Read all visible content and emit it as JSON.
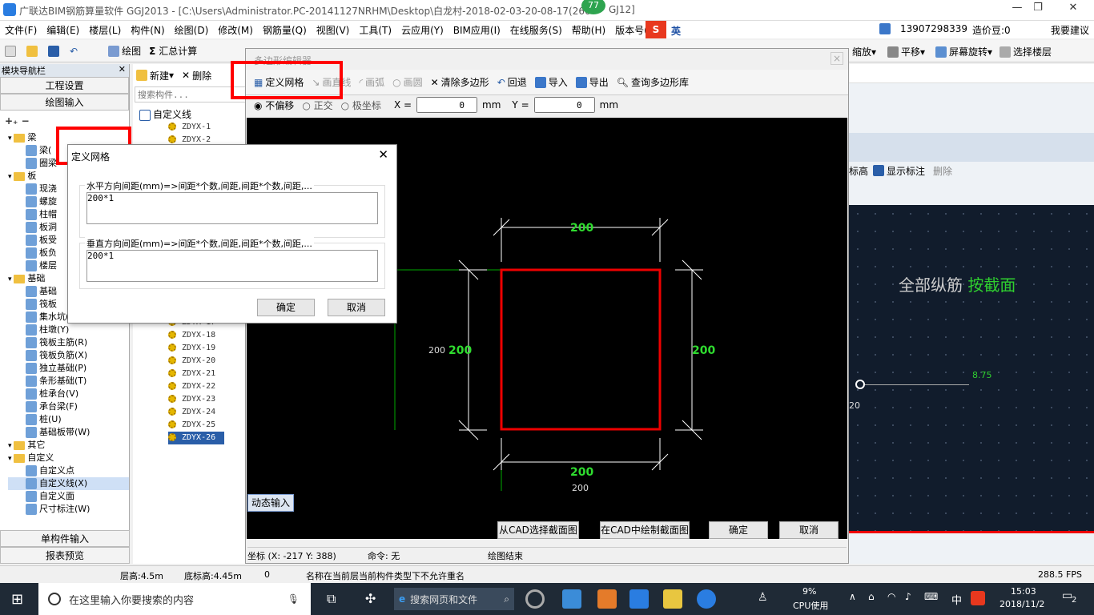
{
  "titlebar": {
    "title": "广联达BIM钢筋算量软件 GGJ2013 - [C:\\Users\\Administrator.PC-20141127NRHM\\Desktop\\白龙村-2018-02-03-20-08-17(266",
    "title_tail": "GJ12]",
    "badge": "77",
    "ime": "英",
    "minimize": "—",
    "restore": "❐",
    "close": "✕"
  },
  "menu": [
    "文件(F)",
    "编辑(E)",
    "楼层(L)",
    "构件(N)",
    "绘图(D)",
    "修改(M)",
    "钢筋量(Q)",
    "视图(V)",
    "工具(T)",
    "云应用(Y)",
    "BIM应用(I)",
    "在线服务(S)",
    "帮助(H)",
    "版本号(B)"
  ],
  "account": {
    "phone": "13907298339",
    "coins": "造价豆:0",
    "feedback": "我要建议"
  },
  "toolbar": {
    "draw": "绘图",
    "sum": "汇总计算",
    "zoom": "缩放",
    "pan": "平移",
    "rotate": "屏幕旋转",
    "select_floor": "选择楼层"
  },
  "nav": {
    "title": "模块导航栏",
    "project": "工程设置",
    "draw_input": "绘图输入",
    "single_input": "单构件输入",
    "report": "报表预览"
  },
  "tree": [
    {
      "t": "梁",
      "lvl": 0,
      "folder": true
    },
    {
      "t": "梁(",
      "lvl": 1
    },
    {
      "t": "圈梁",
      "lvl": 1
    },
    {
      "t": "板",
      "lvl": 0,
      "folder": true
    },
    {
      "t": "现浇",
      "lvl": 1
    },
    {
      "t": "螺旋",
      "lvl": 1
    },
    {
      "t": "柱帽",
      "lvl": 1
    },
    {
      "t": "板洞",
      "lvl": 1
    },
    {
      "t": "板受",
      "lvl": 1
    },
    {
      "t": "板负",
      "lvl": 1
    },
    {
      "t": "楼层",
      "lvl": 1
    },
    {
      "t": "基础",
      "lvl": 0,
      "folder": true
    },
    {
      "t": "基础",
      "lvl": 1
    },
    {
      "t": "筏板",
      "lvl": 1
    },
    {
      "t": "集水坑(K)",
      "lvl": 1
    },
    {
      "t": "柱墩(Y)",
      "lvl": 1
    },
    {
      "t": "筏板主筋(R)",
      "lvl": 1
    },
    {
      "t": "筏板负筋(X)",
      "lvl": 1
    },
    {
      "t": "独立基础(P)",
      "lvl": 1
    },
    {
      "t": "条形基础(T)",
      "lvl": 1
    },
    {
      "t": "桩承台(V)",
      "lvl": 1
    },
    {
      "t": "承台梁(F)",
      "lvl": 1
    },
    {
      "t": "桩(U)",
      "lvl": 1
    },
    {
      "t": "基础板带(W)",
      "lvl": 1
    },
    {
      "t": "其它",
      "lvl": 0,
      "folder": true
    },
    {
      "t": "自定义",
      "lvl": 0,
      "folder": true
    },
    {
      "t": "自定义点",
      "lvl": 1
    },
    {
      "t": "自定义线(X)",
      "lvl": 1,
      "sel": true
    },
    {
      "t": "自定义面",
      "lvl": 1
    },
    {
      "t": "尺寸标注(W)",
      "lvl": 1
    }
  ],
  "mid": {
    "new": "新建",
    "delete": "删除",
    "search_ph": "搜索构件...",
    "root": "自定义线",
    "items": [
      "ZDYX-1",
      "ZDYX-2",
      "ZDYX-16",
      "ZDYX-17",
      "ZDYX-18",
      "ZDYX-19",
      "ZDYX-20",
      "ZDYX-21",
      "ZDYX-22",
      "ZDYX-23",
      "ZDYX-24",
      "ZDYX-25",
      "ZDYX-26"
    ]
  },
  "poly": {
    "title": "多边形编辑器",
    "define_grid": "定义网格",
    "line": "画直线",
    "arc": "画弧",
    "circle": "画圆",
    "clear": "清除多边形",
    "undo": "回退",
    "import": "导入",
    "export": "导出",
    "query": "查询多边形库",
    "no_offset": "不偏移",
    "ortho": "正交",
    "polar": "极坐标",
    "x_label": "X =",
    "x_val": "0",
    "y_label": "Y =",
    "y_val": "0",
    "unit": "mm",
    "dims": {
      "top": "200",
      "bottom": "200",
      "left": "200",
      "right": "200",
      "left_white": "200",
      "bottom_white": "200"
    },
    "dyn_input": "动态输入",
    "cad_select": "从CAD选择截面图",
    "cad_draw": "在CAD中绘制截面图",
    "ok": "确定",
    "cancel": "取消",
    "coord": "坐标 (X: -217 Y: 388)",
    "cmd": "命令: 无",
    "state": "绘图结束"
  },
  "dialog": {
    "title": "定义网格",
    "h_label": "水平方向间距(mm)=>间距*个数,间距,间距*个数,间距,...",
    "h_val": "200*1",
    "v_label": "垂直方向间距(mm)=>间距*个数,间距,间距*个数,间距,...",
    "v_val": "200*1",
    "ok": "确定",
    "cancel": "取消"
  },
  "right": {
    "elev": "标高",
    "show_label": "显示标注",
    "delete": "删除",
    "all_bars": "全部纵筋",
    "by_section": "按截面",
    "val1": "8.75",
    "val2": "20"
  },
  "status": {
    "floor_h": "层高:4.5m",
    "base_h": "底标高:4.45m",
    "zero": "0",
    "msg": "名称在当前层当前构件类型下不允许重名",
    "fps": "288.5 FPS"
  },
  "taskbar": {
    "search": "在这里输入你要搜索的内容",
    "web": "搜索网页和文件",
    "cpu": "9%",
    "cpu_label": "CPU使用",
    "lang": "中",
    "time": "15:03",
    "date": "2018/11/2",
    "notif": "2"
  }
}
